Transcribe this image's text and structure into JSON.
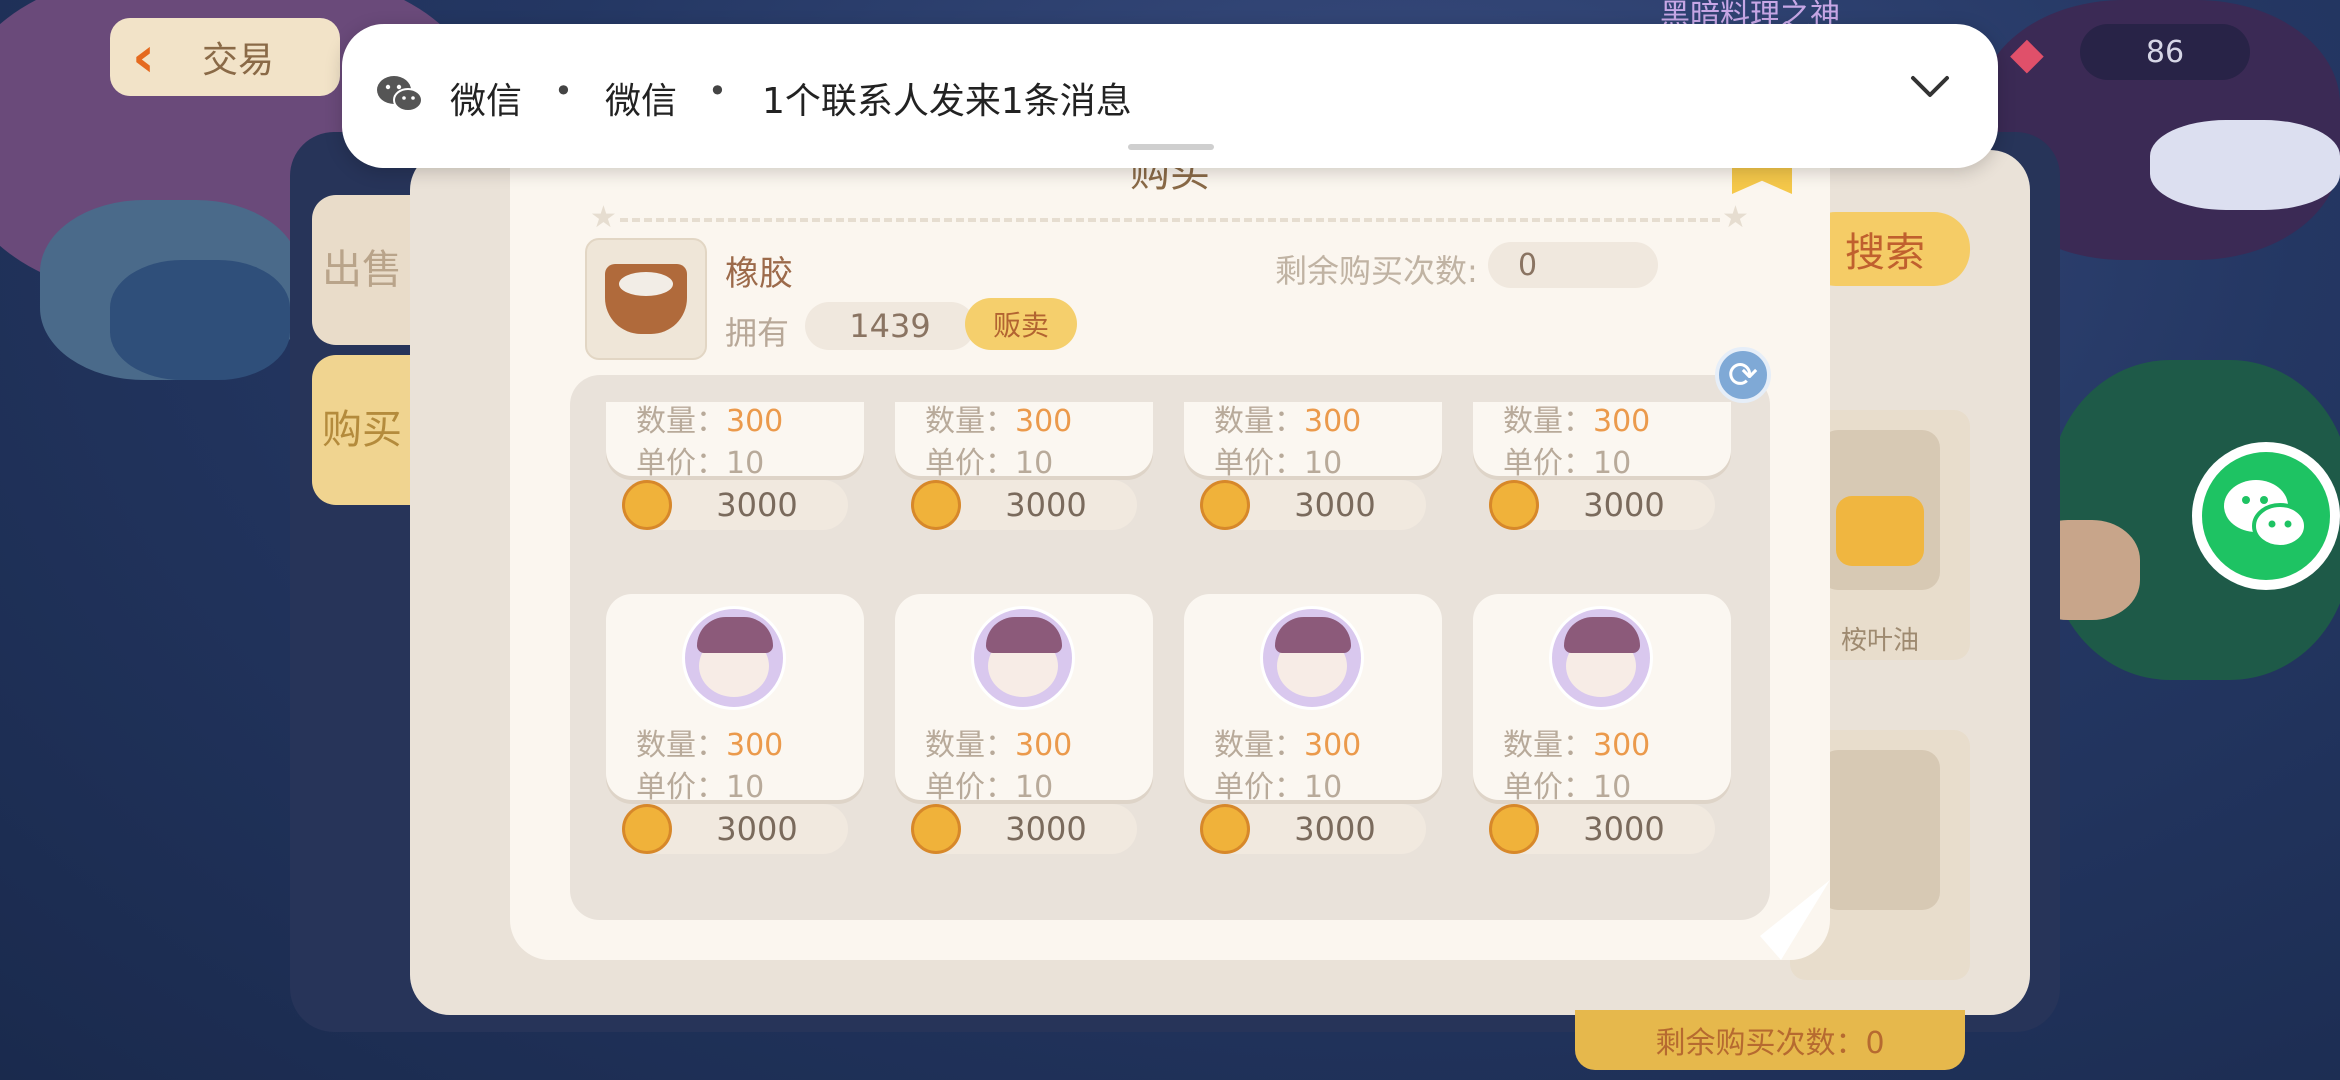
{
  "notification": {
    "app": "微信",
    "source": "微信",
    "message": "1个联系人发来1条消息",
    "separator": "•"
  },
  "top_bar": {
    "trade_title": "交易",
    "event_title": "黑暗料理之神",
    "currency_value": "86"
  },
  "side_tabs": {
    "sell": "出售",
    "buy": "购买"
  },
  "right_panel": {
    "search_label": "搜索",
    "card1_label": "桉叶油",
    "remain_label": "剩余购买次数：0"
  },
  "dialog": {
    "title": "购买",
    "item_name": "橡胶",
    "own_label": "拥有",
    "own_value": "1439",
    "sell_button": "贩卖",
    "remain_label": "剩余购买次数:",
    "remain_value": "0"
  },
  "listings": [
    {
      "qty_label": "数量：",
      "qty": "300",
      "price_label": "单价：",
      "price": "10",
      "total": "3000"
    },
    {
      "qty_label": "数量：",
      "qty": "300",
      "price_label": "单价：",
      "price": "10",
      "total": "3000"
    },
    {
      "qty_label": "数量：",
      "qty": "300",
      "price_label": "单价：",
      "price": "10",
      "total": "3000"
    },
    {
      "qty_label": "数量：",
      "qty": "300",
      "price_label": "单价：",
      "price": "10",
      "total": "3000"
    },
    {
      "qty_label": "数量：",
      "qty": "300",
      "price_label": "单价：",
      "price": "10",
      "total": "3000"
    },
    {
      "qty_label": "数量：",
      "qty": "300",
      "price_label": "单价：",
      "price": "10",
      "total": "3000"
    },
    {
      "qty_label": "数量：",
      "qty": "300",
      "price_label": "单价：",
      "price": "10",
      "total": "3000"
    },
    {
      "qty_label": "数量：",
      "qty": "300",
      "price_label": "单价：",
      "price": "10",
      "total": "3000"
    }
  ],
  "icons": {
    "notification_app": "wechat-icon",
    "expand": "chevron-down-icon",
    "refresh": "refresh-icon",
    "coin": "coin-icon",
    "float": "wechat-float-icon"
  },
  "colors": {
    "wechat_green": "#1ec363",
    "accent_gold": "#f5cf6c",
    "qty_orange": "#eb9a4c"
  }
}
